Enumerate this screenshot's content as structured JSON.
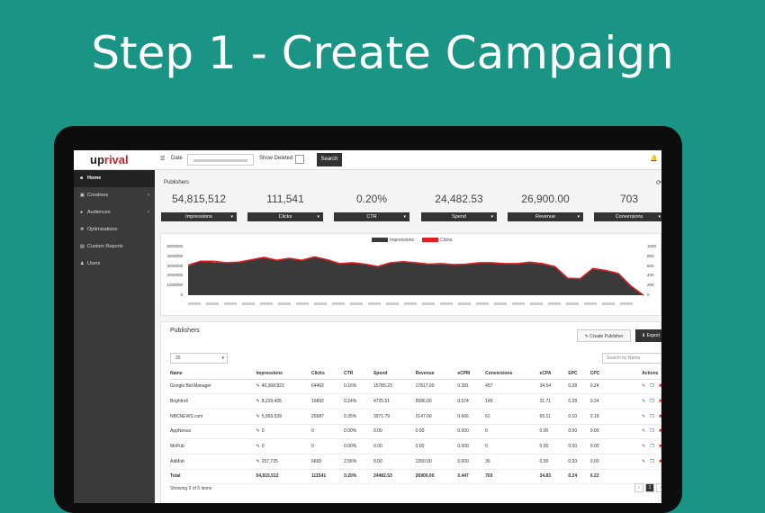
{
  "hero_title": "Step 1 - Create Campaign",
  "app": {
    "logo_a": "up",
    "logo_b": "rival"
  },
  "topbar": {
    "date_label": "Date",
    "show_deleted_label": "Show Deleted",
    "search_label": "Search"
  },
  "sidebar": {
    "items": [
      {
        "label": "Home",
        "icon": "home-icon"
      },
      {
        "label": "Creatives",
        "icon": "image-icon"
      },
      {
        "label": "Audiences",
        "icon": "users-icon"
      },
      {
        "label": "Optimizations",
        "icon": "cogs-icon"
      },
      {
        "label": "Custom Reports",
        "icon": "report-icon"
      },
      {
        "label": "Users",
        "icon": "user-icon"
      }
    ]
  },
  "summary": {
    "title": "Publishers",
    "stats": [
      {
        "value": "54,815,512",
        "label": "Impressions"
      },
      {
        "value": "111,541",
        "label": "Clicks"
      },
      {
        "value": "0.20%",
        "label": "CTR"
      },
      {
        "value": "24,482.53",
        "label": "Spend"
      },
      {
        "value": "26,900.00",
        "label": "Revenue"
      },
      {
        "value": "703",
        "label": "Conversions"
      }
    ]
  },
  "chart_data": {
    "type": "area",
    "legend": [
      "Impressions",
      "Clicks"
    ],
    "colors": {
      "impressions": "#3a3a3a",
      "clicks": "#e31e24"
    },
    "y_left_ticks": [
      "5000000",
      "4000000",
      "3000000",
      "2000000",
      "1000000",
      "0"
    ],
    "y_right_ticks": [
      "1000",
      "800",
      "600",
      "400",
      "200",
      "0"
    ],
    "ylim_left": [
      0,
      5000000
    ],
    "ylim_right": [
      0,
      1000
    ],
    "series": [
      {
        "name": "Impressions",
        "values": [
          3000000,
          3500000,
          3400000,
          3300000,
          3350000,
          3600000,
          3850000,
          3550000,
          3750000,
          3550000,
          3900000,
          3600000,
          3200000,
          3300000,
          3150000,
          2900000,
          3300000,
          3400000,
          3300000,
          3150000,
          3200000,
          3100000,
          3150000,
          3300000,
          3300000,
          3200000,
          3200000,
          3350000,
          3200000,
          2900000,
          1700000,
          1650000,
          2700000,
          2500000,
          2200000,
          900000,
          0
        ]
      },
      {
        "name": "Clicks",
        "values": [
          620,
          700,
          700,
          670,
          680,
          730,
          780,
          720,
          760,
          720,
          790,
          730,
          650,
          670,
          640,
          590,
          670,
          690,
          670,
          640,
          650,
          630,
          640,
          670,
          670,
          650,
          650,
          680,
          650,
          590,
          350,
          340,
          550,
          510,
          450,
          190,
          0
        ]
      }
    ]
  },
  "publishers": {
    "title": "Publishers",
    "create_label": "Create Publisher",
    "export_label": "Export",
    "page_size": "25",
    "search_placeholder": "Search by Name",
    "columns": [
      "Name",
      "Impressions",
      "Clicks",
      "CTR",
      "Spend",
      "Revenue",
      "eCPM",
      "Conversions",
      "eCPA",
      "EPC",
      "CPC",
      "Actions"
    ],
    "rows": [
      [
        "Google Bid Manager",
        "40,368,823",
        "64462",
        "0.16%",
        "15785.23",
        "17817.00",
        "0.391",
        "457",
        "34.54",
        "0.28",
        "0.24"
      ],
      [
        "Brightroll",
        "8,229,425",
        "19892",
        "0.24%",
        "4725.51",
        "5586.00",
        "0.574",
        "149",
        "31.71",
        "0.28",
        "0.24"
      ],
      [
        "NBCNEWS.com",
        "5,959,539",
        "20587",
        "0.35%",
        "3971.79",
        "2147.00",
        "0.666",
        "61",
        "65.11",
        "0.10",
        "0.19"
      ],
      [
        "AppNexus",
        "0",
        "0",
        "0.00%",
        "0.00",
        "0.00",
        "0.000",
        "0",
        "0.00",
        "0.00",
        "0.00"
      ],
      [
        "MoPub",
        "0",
        "0",
        "0.00%",
        "0.00",
        "0.00",
        "0.000",
        "0",
        "0.00",
        "0.00",
        "0.00"
      ],
      [
        "AdMob",
        "257,725",
        "6600",
        "2.56%",
        "0.00",
        "1350.00",
        "0.000",
        "36",
        "0.00",
        "0.20",
        "0.00"
      ]
    ],
    "total": [
      "Total",
      "54,815,512",
      "111541",
      "0.20%",
      "24482.53",
      "26900.00",
      "0.447",
      "703",
      "34.83",
      "0.24",
      "0.22"
    ],
    "footer": "Showing 6 of 6 items",
    "pager": {
      "prev": "‹",
      "current": "1",
      "next": "›"
    }
  }
}
